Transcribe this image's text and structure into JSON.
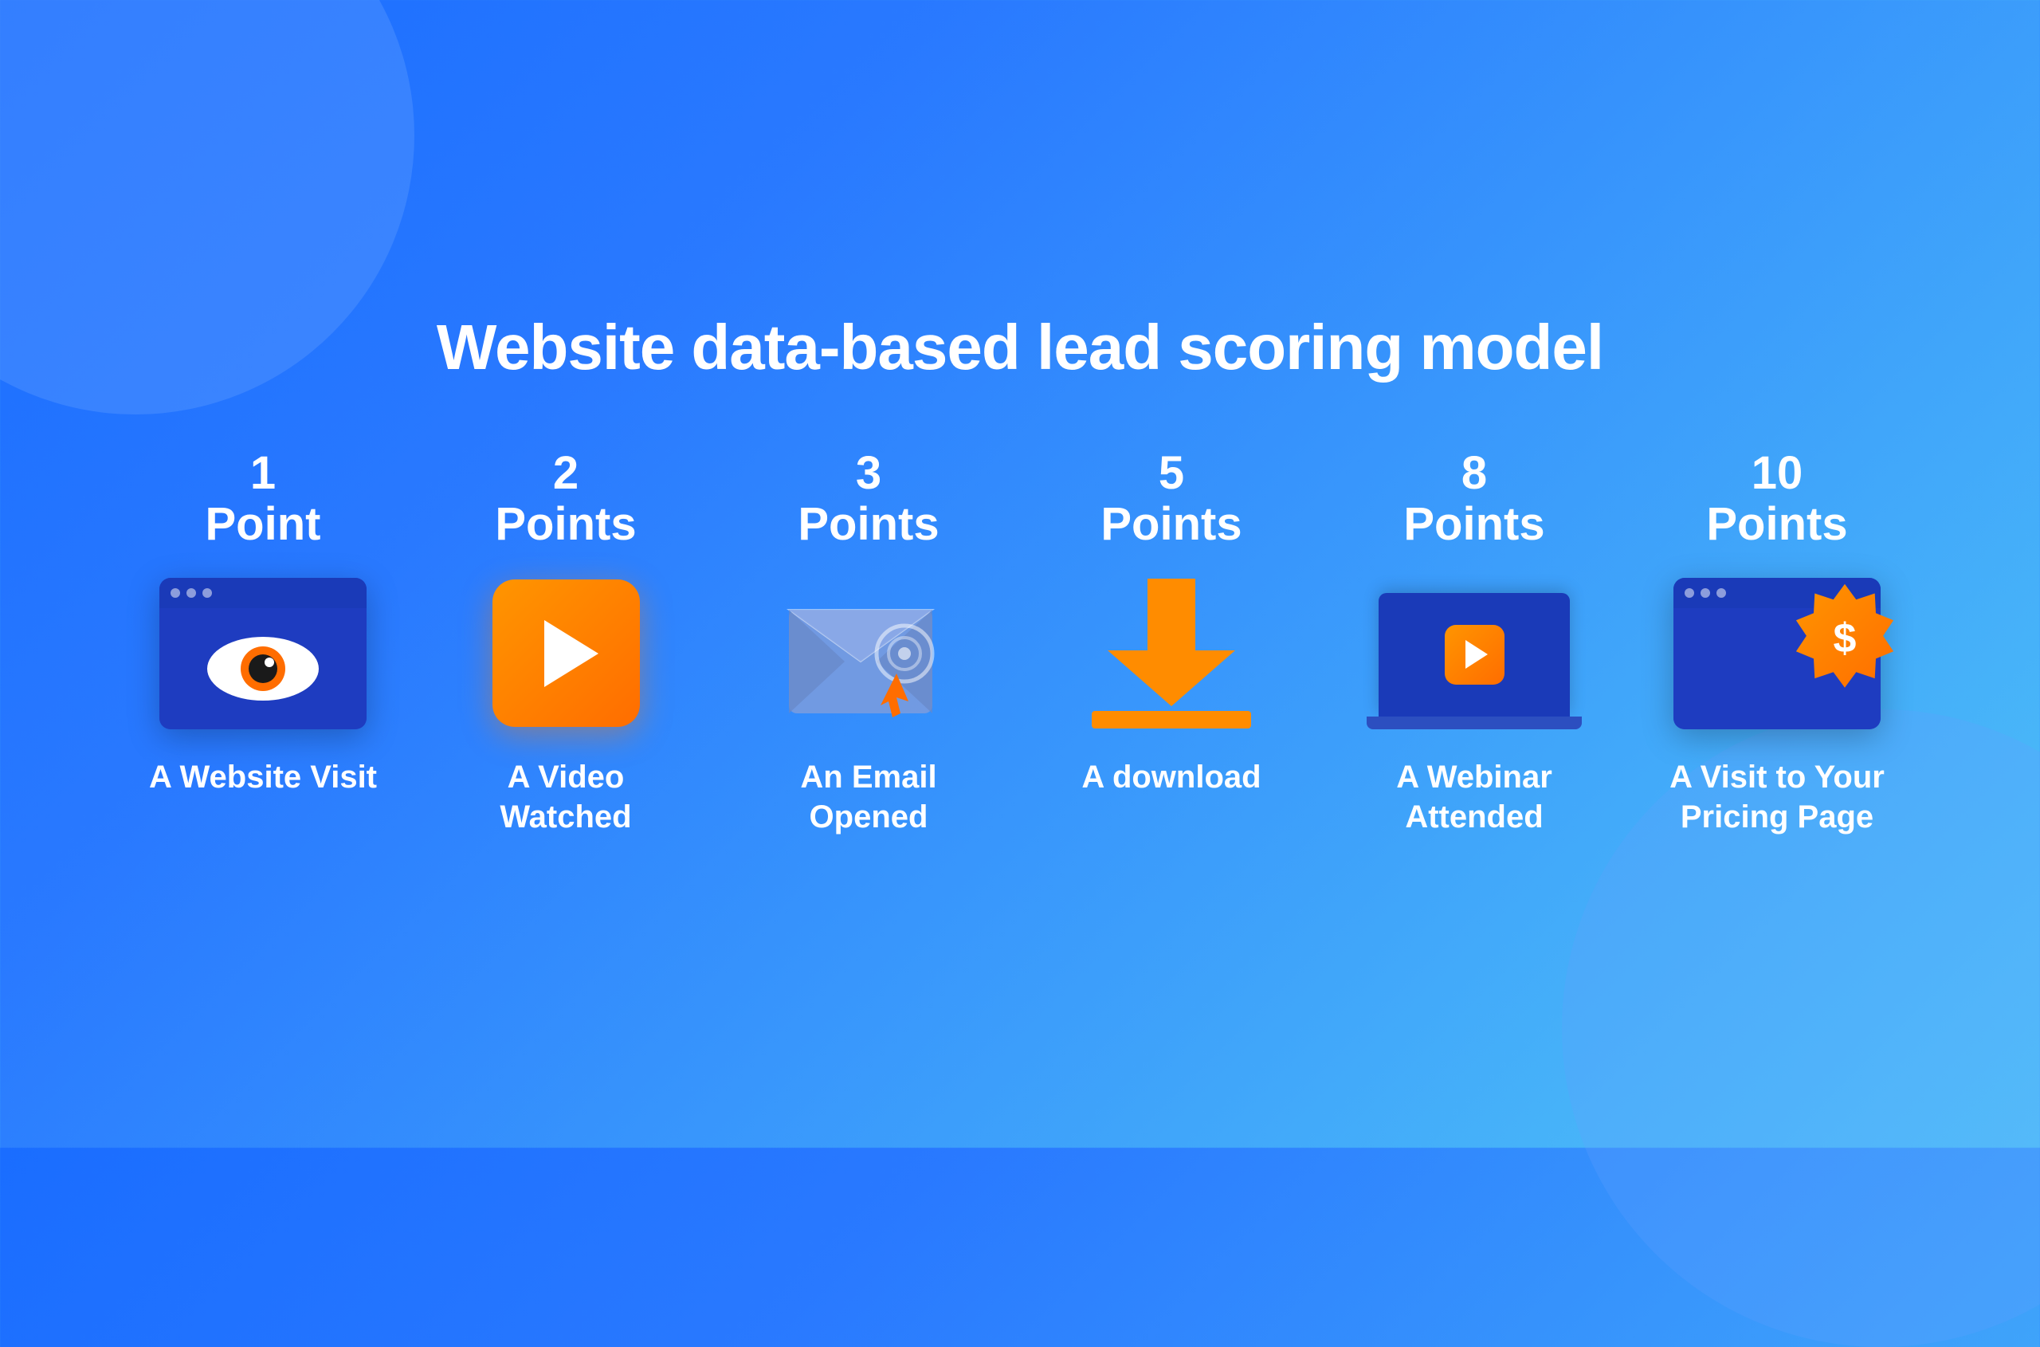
{
  "page": {
    "title": "Website data-based lead scoring model",
    "background": {
      "gradient_start": "#1a6dff",
      "gradient_end": "#4fc3f7"
    }
  },
  "cards": [
    {
      "id": "website-visit",
      "points_number": "1",
      "points_label": "Point",
      "icon_type": "browser-eye",
      "label": "A Website Visit"
    },
    {
      "id": "video-watched",
      "points_number": "2",
      "points_label": "Points",
      "icon_type": "play-square",
      "label": "A Video Watched"
    },
    {
      "id": "email-opened",
      "points_number": "3",
      "points_label": "Points",
      "icon_type": "email-cursor",
      "label": "An Email Opened"
    },
    {
      "id": "download",
      "points_number": "5",
      "points_label": "Points",
      "icon_type": "download-arrow",
      "label": "A download"
    },
    {
      "id": "webinar-attended",
      "points_number": "8",
      "points_label": "Points",
      "icon_type": "laptop-play",
      "label": "A Webinar Attended"
    },
    {
      "id": "pricing-page",
      "points_number": "10",
      "points_label": "Points",
      "icon_type": "pricing-browser",
      "label": "A Visit to Your Pricing Page"
    }
  ]
}
